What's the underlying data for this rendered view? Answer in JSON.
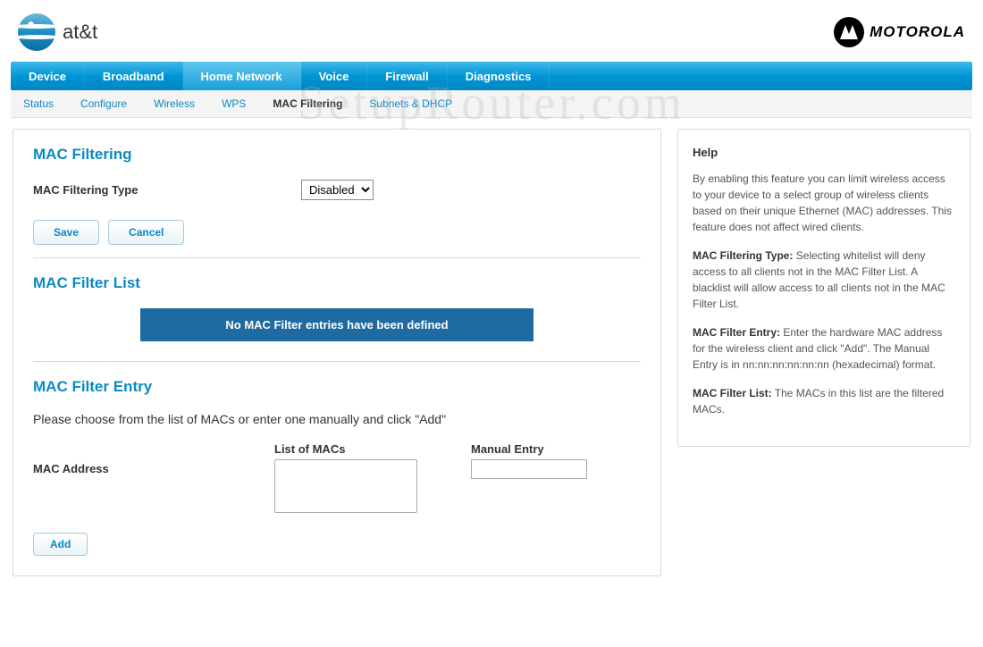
{
  "brand": {
    "left": "at&t",
    "right": "MOTOROLA"
  },
  "watermark": "SetupRouter.com",
  "nav": {
    "primary": [
      "Device",
      "Broadband",
      "Home Network",
      "Voice",
      "Firewall",
      "Diagnostics"
    ],
    "active_primary": 2,
    "secondary": [
      "Status",
      "Configure",
      "Wireless",
      "WPS",
      "MAC Filtering",
      "Subnets & DHCP"
    ],
    "active_secondary": 4
  },
  "main": {
    "title1": "MAC Filtering",
    "type_label": "MAC Filtering Type",
    "type_value": "Disabled",
    "save": "Save",
    "cancel": "Cancel",
    "title2": "MAC Filter List",
    "banner": "No MAC Filter entries have been defined",
    "title3": "MAC Filter Entry",
    "instruction": "Please choose from the list of MACs or enter one manually and click \"Add\"",
    "mac_address_label": "MAC Address",
    "list_head": "List of MACs",
    "manual_head": "Manual Entry",
    "add": "Add"
  },
  "help": {
    "title": "Help",
    "p1": "By enabling this feature you can limit wireless access to your device to a select group of wireless clients based on their unique Ethernet (MAC) addresses. This feature does not affect wired clients.",
    "b2": "MAC Filtering Type:",
    "p2": " Selecting whitelist will deny access to all clients not in the MAC Filter List. A blacklist will allow access to all clients not in the MAC Filter List.",
    "b3": "MAC Filter Entry:",
    "p3": " Enter the hardware MAC address for the wireless client and click \"Add\". The Manual Entry is in nn:nn:nn:nn:nn:nn (hexadecimal) format.",
    "b4": "MAC Filter List:",
    "p4": " The MACs in this list are the filtered MACs."
  }
}
